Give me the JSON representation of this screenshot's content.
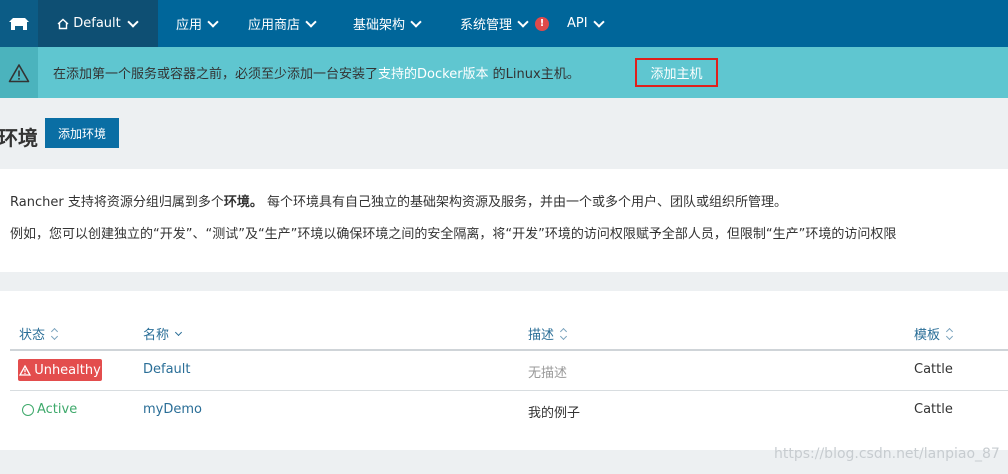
{
  "nav": {
    "env_label": "Default",
    "items": [
      "应用",
      "应用商店",
      "基础架构",
      "系统管理",
      "API"
    ],
    "alert_badge": "!"
  },
  "banner": {
    "text_before": "在添加第一个服务或容器之前，必须至少添加一台安装了",
    "link": "支持的Docker版本",
    "text_after": " 的Linux主机。",
    "button": "添加主机"
  },
  "page": {
    "title": "环境",
    "add_button": "添加环境"
  },
  "info": {
    "line1_before": "Rancher 支持将资源分组归属到多个",
    "line1_bold": "环境。",
    "line1_after": " 每个环境具有自己独立的基础架构资源及服务，并由一个或多个用户、团队或组织所管理。",
    "line2": "例如，您可以创建独立的“开发”、“测试”及“生产”环境以确保环境之间的安全隔离，将“开发”环境的访问权限赋予全部人员，但限制“生产”环境的访问权限"
  },
  "table": {
    "headers": [
      "状态",
      "名称",
      "描述",
      "模板"
    ],
    "rows": [
      {
        "status": "Unhealthy",
        "name": "Default",
        "description": "无描述",
        "template": "Cattle"
      },
      {
        "status": "Active",
        "name": "myDemo",
        "description": "我的例子",
        "template": "Cattle"
      }
    ]
  },
  "watermark": "https://blog.csdn.net/lanpiao_87",
  "colors": {
    "nav_bg": "#00669a",
    "banner_bg": "#5fc6d0",
    "primary_button": "#0a6ea4",
    "unhealthy": "#e34d4d",
    "active": "#3ea96b",
    "highlight_border": "#e0201b"
  }
}
